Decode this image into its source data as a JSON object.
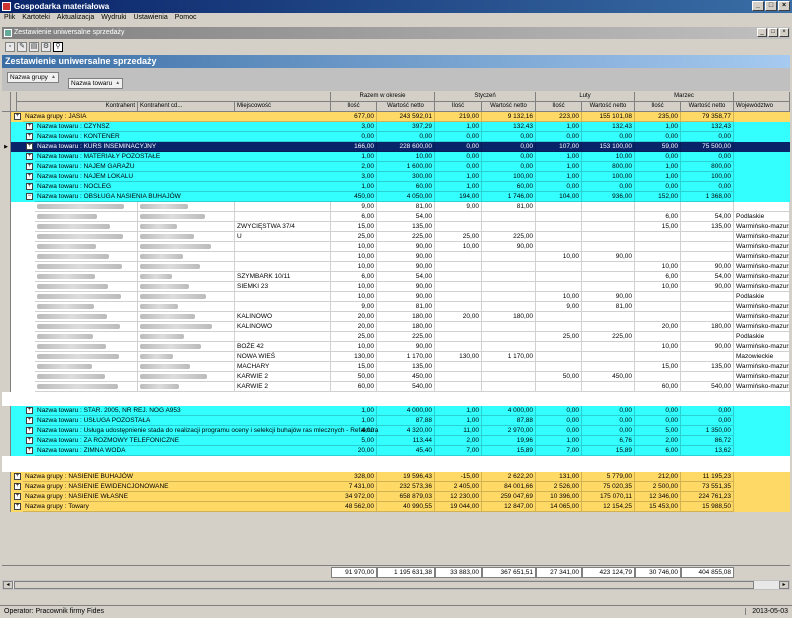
{
  "app": {
    "title": "Gospodarka materiałowa"
  },
  "menu": [
    "Plik",
    "Kartoteki",
    "Aktualizacja",
    "Wydruki",
    "Ustawienia",
    "Pomoc"
  ],
  "child_window": {
    "title": "Zestawienie uniwersalne sprzedaży"
  },
  "report": {
    "title": "Zestawienie uniwersalne sprzedaży"
  },
  "grouping": [
    "Nazwa grupy",
    "Nazwa towaru"
  ],
  "columns": {
    "kontrahent": "Kontrahent",
    "kontrahent_cd": "Kontrahent cd...",
    "miejscowosc": "Miejscowość",
    "wojewodztwo": "Województwo",
    "ilosc": "Ilość",
    "wartosc_netto": "Wartość netto",
    "periods": [
      "Razem w okresie",
      "Styczeń",
      "Luty",
      "Marzec"
    ]
  },
  "rows": [
    {
      "type": "group",
      "label": "Nazwa grupy : JASIA",
      "v": [
        "677,00",
        "243 592,01",
        "219,00",
        "9 132,16",
        "223,00",
        "155 101,08",
        "235,00",
        "79 358,77"
      ]
    },
    {
      "type": "sub",
      "label": "Nazwa towaru : CZYNSZ",
      "v": [
        "3,00",
        "397,29",
        "1,00",
        "132,43",
        "1,00",
        "132,43",
        "1,00",
        "132,43"
      ]
    },
    {
      "type": "sub",
      "label": "Nazwa towaru : KONTENER",
      "v": [
        "0,00",
        "0,00",
        "0,00",
        "0,00",
        "0,00",
        "0,00",
        "0,00",
        "0,00"
      ]
    },
    {
      "type": "sel",
      "label": "Nazwa towaru : KURS INSEMINACYJNY",
      "v": [
        "166,00",
        "228 600,00",
        "0,00",
        "0,00",
        "107,00",
        "153 100,00",
        "59,00",
        "75 500,00"
      ]
    },
    {
      "type": "sub",
      "label": "Nazwa towaru : MATERIAŁY POZOSTAŁE",
      "v": [
        "1,00",
        "10,00",
        "0,00",
        "0,00",
        "1,00",
        "10,00",
        "0,00",
        "0,00"
      ]
    },
    {
      "type": "sub",
      "label": "Nazwa towaru : NAJEM GARAŻU",
      "v": [
        "2,00",
        "1 600,00",
        "0,00",
        "0,00",
        "1,00",
        "800,00",
        "1,00",
        "800,00"
      ]
    },
    {
      "type": "sub",
      "label": "Nazwa towaru : NAJEM LOKALU",
      "v": [
        "3,00",
        "300,00",
        "1,00",
        "100,00",
        "1,00",
        "100,00",
        "1,00",
        "100,00"
      ]
    },
    {
      "type": "sub",
      "label": "Nazwa towaru : NOCLEG",
      "v": [
        "1,00",
        "60,00",
        "1,00",
        "60,00",
        "0,00",
        "0,00",
        "0,00",
        "0,00"
      ]
    },
    {
      "type": "sub",
      "open": true,
      "label": "Nazwa towaru : OBSŁUGA NASIENIA BUHAJÓW",
      "v": [
        "450,00",
        "4 050,00",
        "194,00",
        "1 746,00",
        "104,00",
        "936,00",
        "152,00",
        "1 368,00"
      ]
    },
    {
      "type": "detail",
      "m": "",
      "v": [
        "9,00",
        "81,00",
        "9,00",
        "81,00",
        "",
        "",
        "",
        ""
      ],
      "w": ""
    },
    {
      "type": "detail",
      "m": "",
      "v": [
        "6,00",
        "54,00",
        "",
        "",
        "",
        "",
        "6,00",
        "54,00"
      ],
      "w": "Podlaskie"
    },
    {
      "type": "detail",
      "m": "ZWYCIĘSTWA 37/4",
      "v": [
        "15,00",
        "135,00",
        "",
        "",
        "",
        "",
        "15,00",
        "135,00"
      ],
      "w": "Warmińsko-mazurs"
    },
    {
      "type": "detail",
      "m": "U",
      "v": [
        "25,00",
        "225,00",
        "25,00",
        "225,00",
        "",
        "",
        "",
        ""
      ],
      "w": "Warmińsko-mazurs"
    },
    {
      "type": "detail",
      "m": "",
      "v": [
        "10,00",
        "90,00",
        "10,00",
        "90,00",
        "",
        "",
        "",
        ""
      ],
      "w": "Warmińsko-mazurs"
    },
    {
      "type": "detail",
      "m": "",
      "v": [
        "10,00",
        "90,00",
        "",
        "",
        "10,00",
        "90,00",
        "",
        ""
      ],
      "w": "Warmińsko-mazurs"
    },
    {
      "type": "detail",
      "m": "",
      "v": [
        "10,00",
        "90,00",
        "",
        "",
        "",
        "",
        "10,00",
        "90,00"
      ],
      "w": "Warmińsko-mazurs"
    },
    {
      "type": "detail",
      "m": "SZYMBARK 10/11",
      "v": [
        "6,00",
        "54,00",
        "",
        "",
        "",
        "",
        "6,00",
        "54,00"
      ],
      "w": "Warmińsko-mazurs"
    },
    {
      "type": "detail",
      "m": "SIEMKI 23",
      "v": [
        "10,00",
        "90,00",
        "",
        "",
        "",
        "",
        "10,00",
        "90,00"
      ],
      "w": "Warmińsko-mazurs"
    },
    {
      "type": "detail",
      "m": "",
      "v": [
        "10,00",
        "90,00",
        "",
        "",
        "10,00",
        "90,00",
        "",
        ""
      ],
      "w": "Podlaskie"
    },
    {
      "type": "detail",
      "m": "",
      "v": [
        "9,00",
        "81,00",
        "",
        "",
        "9,00",
        "81,00",
        "",
        ""
      ],
      "w": "Warmińsko-mazurs"
    },
    {
      "type": "detail",
      "m": "KALINOWO",
      "v": [
        "20,00",
        "180,00",
        "20,00",
        "180,00",
        "",
        "",
        "",
        ""
      ],
      "w": "Warmińsko-mazurs"
    },
    {
      "type": "detail",
      "m": "KALINOWO",
      "v": [
        "20,00",
        "180,00",
        "",
        "",
        "",
        "",
        "20,00",
        "180,00"
      ],
      "w": "Warmińsko-mazurs"
    },
    {
      "type": "detail",
      "m": "",
      "v": [
        "25,00",
        "225,00",
        "",
        "",
        "25,00",
        "225,00",
        "",
        ""
      ],
      "w": "Podlaskie"
    },
    {
      "type": "detail",
      "m": "BOŻE 42",
      "v": [
        "10,00",
        "90,00",
        "",
        "",
        "",
        "",
        "10,00",
        "90,00"
      ],
      "w": "Warmińsko-mazurs"
    },
    {
      "type": "detail",
      "m": "NOWA WIEŚ",
      "v": [
        "130,00",
        "1 170,00",
        "130,00",
        "1 170,00",
        "",
        "",
        "",
        ""
      ],
      "w": "Mazowieckie"
    },
    {
      "type": "detail",
      "m": "MACHARY",
      "v": [
        "15,00",
        "135,00",
        "",
        "",
        "",
        "",
        "15,00",
        "135,00"
      ],
      "w": "Warmińsko-mazurs"
    },
    {
      "type": "detail",
      "m": "KARWIE 2",
      "v": [
        "50,00",
        "450,00",
        "",
        "",
        "50,00",
        "450,00",
        "",
        ""
      ],
      "w": "Warmińsko-mazurs"
    },
    {
      "type": "detail",
      "m": "KARWIE 2",
      "v": [
        "60,00",
        "540,00",
        "",
        "",
        "",
        "",
        "60,00",
        "540,00"
      ],
      "w": "Warmińsko-mazurs"
    },
    {
      "type": "blank"
    },
    {
      "type": "sub",
      "label": "Nazwa towaru : STAR. 2005, NR REJ. NOG A953",
      "v": [
        "1,00",
        "4 000,00",
        "1,00",
        "4 000,00",
        "0,00",
        "0,00",
        "0,00",
        "0,00"
      ]
    },
    {
      "type": "sub",
      "label": "Nazwa towaru : USŁUGA POZOSTAŁA",
      "v": [
        "1,00",
        "87,88",
        "1,00",
        "87,88",
        "0,00",
        "0,00",
        "0,00",
        "0,00"
      ]
    },
    {
      "type": "sub",
      "label": "Nazwa towaru : Usługa udostępnienie stada do realizacji programu oceny i selekcji buhajów ras mlecznych - Refaktura",
      "v": [
        "4,00",
        "4 320,00",
        "11,00",
        "2 970,00",
        "0,00",
        "0,00",
        "5,00",
        "1 350,00"
      ]
    },
    {
      "type": "sub",
      "label": "Nazwa towaru : ZA ROZMOWY TELEFONICZNE",
      "v": [
        "5,00",
        "113,44",
        "2,00",
        "19,96",
        "1,00",
        "6,76",
        "2,00",
        "86,72"
      ]
    },
    {
      "type": "sub",
      "label": "Nazwa towaru : ZIMNA WODA",
      "v": [
        "20,00",
        "45,40",
        "7,00",
        "15,89",
        "7,00",
        "15,89",
        "6,00",
        "13,62"
      ]
    },
    {
      "type": "blank2"
    },
    {
      "type": "group",
      "label": "Nazwa grupy : NASIENIE BUHAJÓW",
      "v": [
        "328,00",
        "19 596,43",
        "-15,00",
        "2 622,20",
        "131,00",
        "5 779,00",
        "212,00",
        "11 195,23"
      ]
    },
    {
      "type": "group",
      "label": "Nazwa grupy : NASIENIE EWIDENCJONOWANE",
      "v": [
        "7 431,00",
        "232 573,36",
        "2 405,00",
        "84 001,66",
        "2 526,00",
        "75 020,35",
        "2 500,00",
        "73 551,35"
      ]
    },
    {
      "type": "group",
      "label": "Nazwa grupy : NASIENIE WŁASNE",
      "v": [
        "34 972,00",
        "658 879,03",
        "12 230,00",
        "259 047,69",
        "10 396,00",
        "175 070,11",
        "12 346,00",
        "224 761,23"
      ]
    },
    {
      "type": "group",
      "label": "Nazwa grupy : Towary",
      "v": [
        "48 562,00",
        "40 990,55",
        "19 044,00",
        "12 847,00",
        "14 065,00",
        "12 154,25",
        "15 453,00",
        "15 988,50"
      ]
    }
  ],
  "totals": [
    "91 970,00",
    "1 195 631,38",
    "33 883,00",
    "367 651,51",
    "27 341,00",
    "423 124,79",
    "30 746,00",
    "404 855,08"
  ],
  "status": {
    "operator": "Operator: Pracownik firmy Fides",
    "date": "2013-05-03"
  }
}
